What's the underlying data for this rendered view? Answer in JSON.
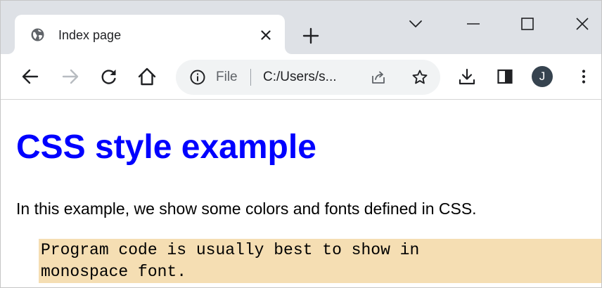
{
  "browser": {
    "tab": {
      "title": "Index page",
      "favicon": "globe-icon",
      "close_icon": "close-icon"
    },
    "new_tab_icon": "plus-icon",
    "window_controls": [
      "chevron-down-icon",
      "minimize-icon",
      "maximize-icon",
      "close-icon"
    ],
    "toolbar": {
      "icons": [
        "back-arrow-icon",
        "forward-arrow-icon",
        "reload-icon",
        "home-icon",
        "download-icon",
        "side-panel-icon",
        "kebab-menu-icon"
      ],
      "avatar_letter": "J"
    },
    "omnibox": {
      "info_icon": "info-icon",
      "scheme_label": "File",
      "url": "C:/Users/s...",
      "share_icon": "share-icon",
      "bookmark_icon": "star-icon"
    }
  },
  "page": {
    "heading": "CSS style example",
    "paragraph": "In this example, we show some colors and fonts defined in CSS.",
    "code_lines": [
      "Program code is usually best to show in",
      "monospace font."
    ]
  },
  "colors": {
    "heading": "#0000ff",
    "code_background": "#f5deb3",
    "tabstrip": "#dee1e6",
    "omnibox": "#f1f3f4",
    "avatar": "#36434f",
    "forward_disabled": "#b8bcc1"
  }
}
